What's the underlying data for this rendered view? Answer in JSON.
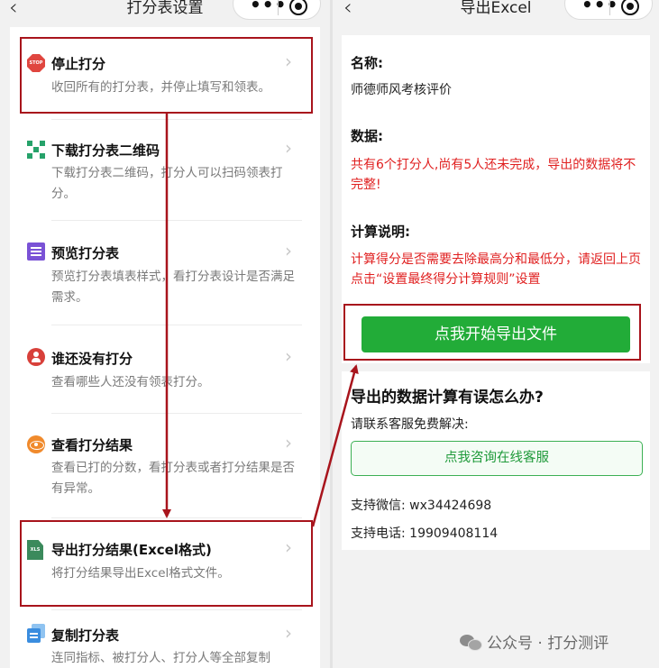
{
  "colors": {
    "highlight_red": "#a8141c",
    "warning_red": "#e02020",
    "wechat_green": "#22ac38"
  },
  "left_screen": {
    "title": "打分表设置",
    "back_icon": "chevron-left-icon",
    "menu_items": [
      {
        "icon": "stop-icon",
        "icon_text": "STOP",
        "title": "停止打分",
        "desc": "收回所有的打分表，并停止填写和领表。"
      },
      {
        "icon": "qr-code-icon",
        "title": "下载打分表二维码",
        "desc": "下载打分表二维码，打分人可以扫码领表打分。"
      },
      {
        "icon": "document-icon",
        "title": "预览打分表",
        "desc": "预览打分表填表样式，看打分表设计是否满足需求。"
      },
      {
        "icon": "person-alert-icon",
        "title": "谁还没有打分",
        "desc": "查看哪些人还没有领表打分。"
      },
      {
        "icon": "eye-icon",
        "title": "查看打分结果",
        "desc": "查看已打的分数，看打分表或者打分结果是否有异常。"
      },
      {
        "icon": "excel-icon",
        "icon_text": "XLS",
        "title": "导出打分结果(Excel格式)",
        "desc": "将打分结果导出Excel格式文件。"
      },
      {
        "icon": "copy-icon",
        "title": "复制打分表",
        "desc": "连同指标、被打分人、打分人等全部复制"
      }
    ]
  },
  "right_screen": {
    "title": "导出Excel",
    "back_icon": "chevron-left-icon",
    "name_label": "名称:",
    "name_value": "师德师风考核评价",
    "data_label": "数据:",
    "data_warning": "共有6个打分人,尚有5人还未完成，导出的数据将不完整!",
    "calc_label": "计算说明:",
    "calc_warning": "计算得分是否需要去除最高分和最低分，请返回上页点击“设置最终得分计算规则”设置",
    "export_button": "点我开始导出文件",
    "help_title": "导出的数据计算有误怎么办?",
    "help_text": "请联系客服免费解决:",
    "service_button": "点我咨询在线客服",
    "wechat_label": "支持微信:",
    "wechat_value": "wx34424698",
    "phone_label": "支持电话:",
    "phone_value": "19909408114"
  },
  "watermark": {
    "text": "公众号 · 打分测评",
    "icon": "wechat-icon"
  }
}
